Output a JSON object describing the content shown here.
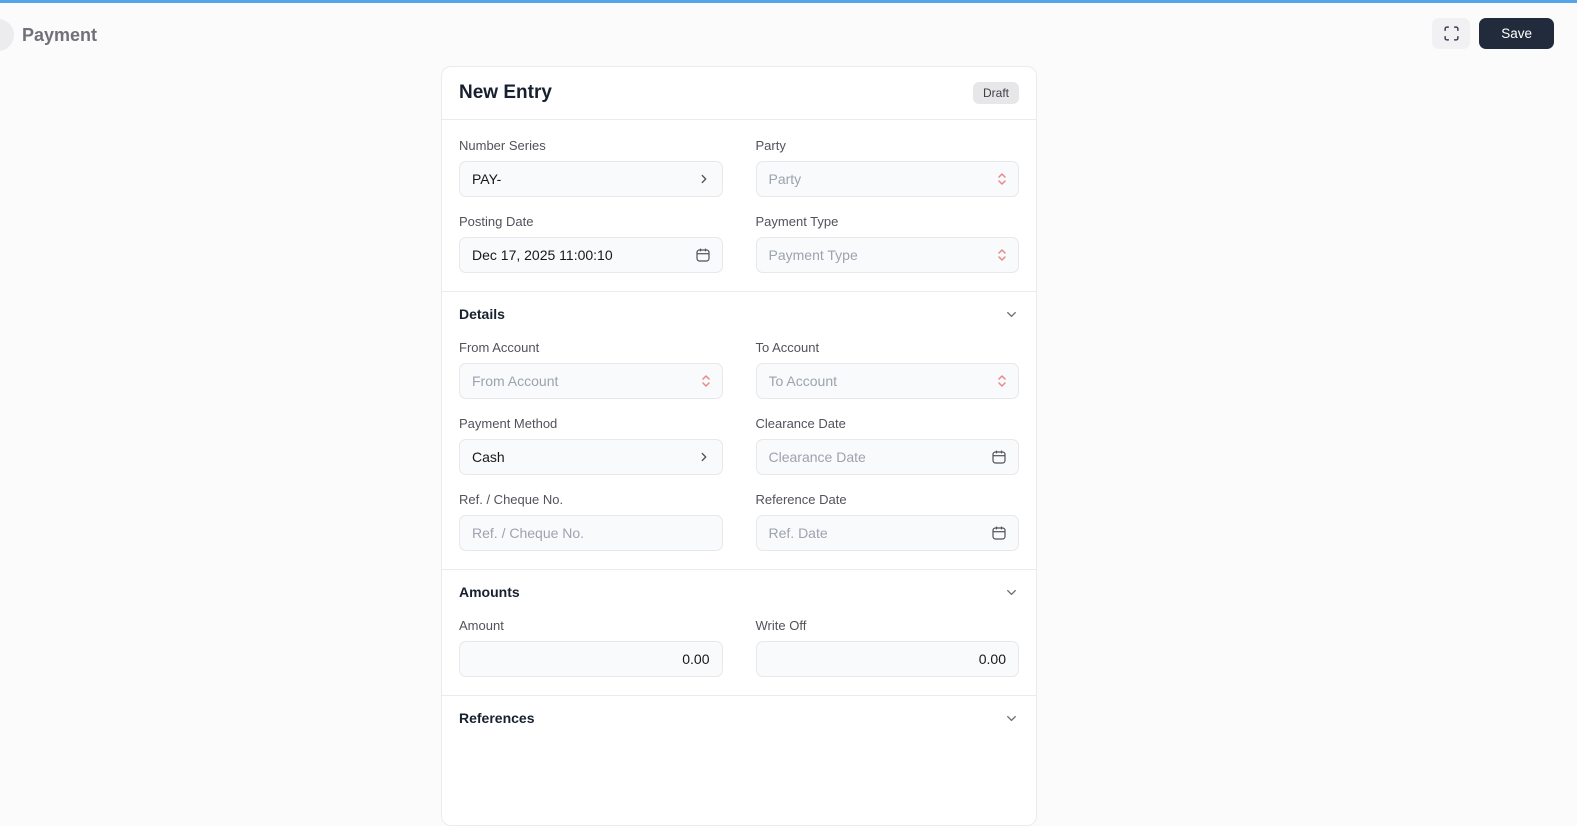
{
  "colors": {
    "top_accent": "#55a3e8",
    "save_button_bg": "#222b3c",
    "required_indicator": "#e78989",
    "badge_bg": "#e7e7e9",
    "field_bg": "#f9fafb"
  },
  "header": {
    "title": "Payment",
    "save_label": "Save",
    "icons": {
      "back": "back-circle",
      "fullscreen": "scan-corners-icon"
    }
  },
  "form": {
    "title": "New Entry",
    "status": "Draft",
    "fields": {
      "number_series": {
        "label": "Number Series",
        "value": "PAY-",
        "icon": "chevron-right-icon"
      },
      "party": {
        "label": "Party",
        "placeholder": "Party",
        "icon": "sorter-updown-icon"
      },
      "posting_date": {
        "label": "Posting Date",
        "value": "Dec 17, 2025 11:00:10",
        "icon": "calendar-icon"
      },
      "payment_type": {
        "label": "Payment Type",
        "placeholder": "Payment Type",
        "icon": "sorter-updown-icon"
      },
      "from_account": {
        "label": "From Account",
        "placeholder": "From Account",
        "icon": "sorter-updown-icon"
      },
      "to_account": {
        "label": "To Account",
        "placeholder": "To Account",
        "icon": "sorter-updown-icon"
      },
      "payment_method": {
        "label": "Payment Method",
        "value": "Cash",
        "icon": "chevron-right-icon"
      },
      "clearance_date": {
        "label": "Clearance Date",
        "placeholder": "Clearance Date",
        "icon": "calendar-icon"
      },
      "ref_cheque_no": {
        "label": "Ref. / Cheque No.",
        "placeholder": "Ref. / Cheque No."
      },
      "reference_date": {
        "label": "Reference Date",
        "placeholder": "Ref. Date",
        "icon": "calendar-icon"
      },
      "amount": {
        "label": "Amount",
        "value": "0.00"
      },
      "write_off": {
        "label": "Write Off",
        "value": "0.00"
      }
    },
    "sections": {
      "details": "Details",
      "amounts": "Amounts",
      "references": "References"
    }
  }
}
